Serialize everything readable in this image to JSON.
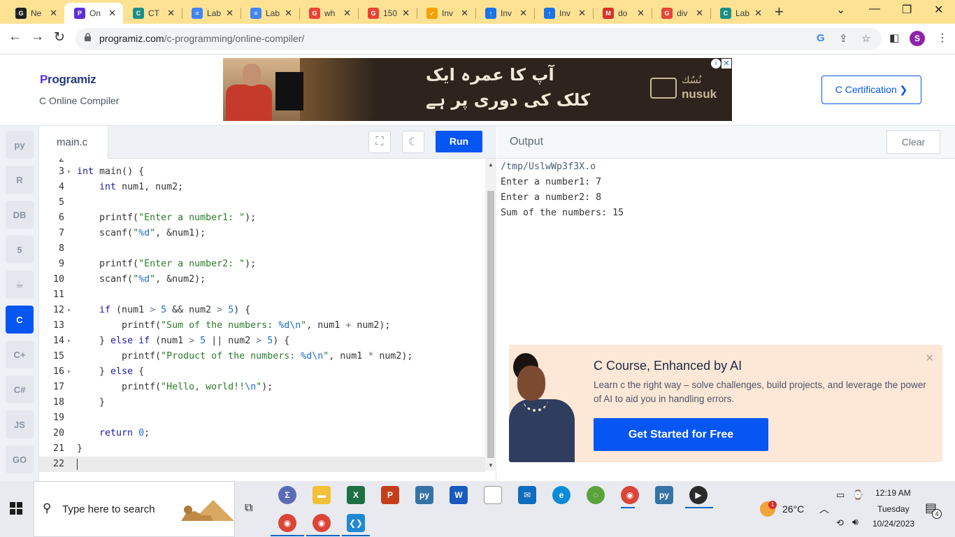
{
  "browser": {
    "tabs": [
      {
        "title": "Ne",
        "fav_color": "#202124",
        "fav_glyph": "G"
      },
      {
        "title": "On",
        "fav_color": "#5c2fd6",
        "fav_glyph": "P",
        "active": true
      },
      {
        "title": "CT",
        "fav_color": "#1a8f86",
        "fav_glyph": "C"
      },
      {
        "title": "Lab",
        "fav_color": "#4285f4",
        "fav_glyph": "≡"
      },
      {
        "title": "Lab",
        "fav_color": "#4285f4",
        "fav_glyph": "≡"
      },
      {
        "title": "wh",
        "fav_color": "#ea4335",
        "fav_glyph": "G"
      },
      {
        "title": "150",
        "fav_color": "#ea4335",
        "fav_glyph": "G"
      },
      {
        "title": "Inv",
        "fav_color": "#f4a100",
        "fav_glyph": "➶"
      },
      {
        "title": "Inv",
        "fav_color": "#1a73e8",
        "fav_glyph": "↑"
      },
      {
        "title": "Inv",
        "fav_color": "#1a73e8",
        "fav_glyph": "↑"
      },
      {
        "title": "do",
        "fav_color": "#d93025",
        "fav_glyph": "M"
      },
      {
        "title": "div",
        "fav_color": "#ea4335",
        "fav_glyph": "G"
      },
      {
        "title": "Lab",
        "fav_color": "#1a8f86",
        "fav_glyph": "C"
      }
    ],
    "url_domain": "programiz.com",
    "url_path": "/c-programming/online-compiler/",
    "profile_initial": "S"
  },
  "header": {
    "logo_initial": "P",
    "logo_text": "rogramiz",
    "subtitle": "C Online Compiler",
    "ad_line1": "آپ کا عمرہ ایک",
    "ad_line2": "کلک کی دوری پر ہے",
    "ad_brand_ar": "نُسُك",
    "ad_brand_en": "nusuk",
    "cert_button": "C Certification ❯"
  },
  "sidebar": {
    "languages": [
      {
        "name": "python",
        "glyph": "py"
      },
      {
        "name": "r",
        "glyph": "R"
      },
      {
        "name": "sql",
        "glyph": "DB"
      },
      {
        "name": "html",
        "glyph": "5"
      },
      {
        "name": "java",
        "glyph": "☕"
      },
      {
        "name": "c",
        "glyph": "C",
        "active": true
      },
      {
        "name": "cpp",
        "glyph": "C+"
      },
      {
        "name": "csharp",
        "glyph": "C#"
      },
      {
        "name": "javascript",
        "glyph": "JS"
      },
      {
        "name": "go",
        "glyph": "GO"
      }
    ]
  },
  "editor": {
    "filename": "main.c",
    "run_label": "Run",
    "partial_line_number": "2",
    "lines": [
      {
        "n": "3",
        "fold": true,
        "html": "<span class=\"kw\">int</span> main() {"
      },
      {
        "n": "4",
        "html": "    <span class=\"kw\">int</span> num1, num2;"
      },
      {
        "n": "5",
        "html": ""
      },
      {
        "n": "6",
        "html": "    printf(<span class=\"str\">\"Enter a number1: \"</span>);"
      },
      {
        "n": "7",
        "html": "    scanf(<span class=\"str\">\"<span class=\"num\">%d</span>\"</span>, &amp;num1);"
      },
      {
        "n": "8",
        "html": ""
      },
      {
        "n": "9",
        "html": "    printf(<span class=\"str\">\"Enter a number2: \"</span>);"
      },
      {
        "n": "10",
        "html": "    scanf(<span class=\"str\">\"<span class=\"num\">%d</span>\"</span>, &amp;num2);"
      },
      {
        "n": "11",
        "html": ""
      },
      {
        "n": "12",
        "fold": true,
        "html": "    <span class=\"kw\">if</span> (num1 <span class=\"op\">&gt;</span> <span class=\"num\">5</span> &amp;&amp; num2 <span class=\"op\">&gt;</span> <span class=\"num\">5</span>) {"
      },
      {
        "n": "13",
        "html": "        printf(<span class=\"str\">\"Sum of the numbers: <span class=\"num\">%d\\n</span>\"</span>, num1 <span class=\"op\">+</span> num2);"
      },
      {
        "n": "14",
        "fold": true,
        "html": "    } <span class=\"kw\">else if</span> (num1 <span class=\"op\">&gt;</span> <span class=\"num\">5</span> || num2 <span class=\"op\">&gt;</span> <span class=\"num\">5</span>) {"
      },
      {
        "n": "15",
        "html": "        printf(<span class=\"str\">\"Product of the numbers: <span class=\"num\">%d\\n</span>\"</span>, num1 <span class=\"op\">*</span> num2);"
      },
      {
        "n": "16",
        "fold": true,
        "html": "    } <span class=\"kw\">else</span> {"
      },
      {
        "n": "17",
        "html": "        printf(<span class=\"str\">\"Hello, world!!<span class=\"num\">\\n</span>\"</span>);"
      },
      {
        "n": "18",
        "html": "    }"
      },
      {
        "n": "19",
        "html": ""
      },
      {
        "n": "20",
        "html": "    <span class=\"kw\">return</span> <span class=\"num\">0</span>;"
      },
      {
        "n": "21",
        "html": "}"
      },
      {
        "n": "22",
        "html": "",
        "current": true
      }
    ]
  },
  "output": {
    "title": "Output",
    "clear_label": "Clear",
    "lines": [
      "/tmp/UslwWp3f3X.o",
      "Enter a number1: 7",
      "Enter a number2: 8",
      "Sum of the numbers: 15"
    ]
  },
  "promo": {
    "title": "C Course, Enhanced by AI",
    "body": "Learn c the right way – solve challenges, build projects, and leverage the power of AI to aid you in handling errors.",
    "button": "Get Started for Free"
  },
  "taskbar": {
    "search_placeholder": "Type here to search",
    "weather": "26°C",
    "time": "12:19 AM",
    "day": "Tuesday",
    "date": "10/24/2023",
    "notification_count": "4",
    "weather_alert_count": "1",
    "apps": [
      {
        "name": "calculator",
        "color": "#5b6bb8",
        "glyph": "Σ"
      },
      {
        "name": "file-explorer",
        "color": "#f2c037",
        "glyph": "▬"
      },
      {
        "name": "excel",
        "color": "#1d7044",
        "glyph": "X"
      },
      {
        "name": "powerpoint",
        "color": "#c43e1c",
        "glyph": "P"
      },
      {
        "name": "python",
        "color": "#3572a5",
        "glyph": "py"
      },
      {
        "name": "word",
        "color": "#185abd",
        "glyph": "W"
      },
      {
        "name": "file",
        "color": "#ffffff",
        "glyph": ""
      },
      {
        "name": "mail",
        "color": "#0f6cbd",
        "glyph": "✉"
      },
      {
        "name": "edge",
        "color": "#0c8bd6",
        "glyph": "e"
      },
      {
        "name": "loader",
        "color": "#5aa33c",
        "glyph": "◌"
      },
      {
        "name": "chrome-profile",
        "color": "#db4437",
        "glyph": "◉"
      },
      {
        "name": "python-idle",
        "color": "#3572a5",
        "glyph": "py"
      },
      {
        "name": "media-player",
        "color": "#2a2a2a",
        "glyph": "▶"
      },
      {
        "name": "chrome",
        "color": "#db4437",
        "glyph": "◉"
      },
      {
        "name": "chrome-2",
        "color": "#db4437",
        "glyph": "◉"
      },
      {
        "name": "vscode",
        "color": "#1f8ad2",
        "glyph": "❮❯"
      }
    ]
  }
}
